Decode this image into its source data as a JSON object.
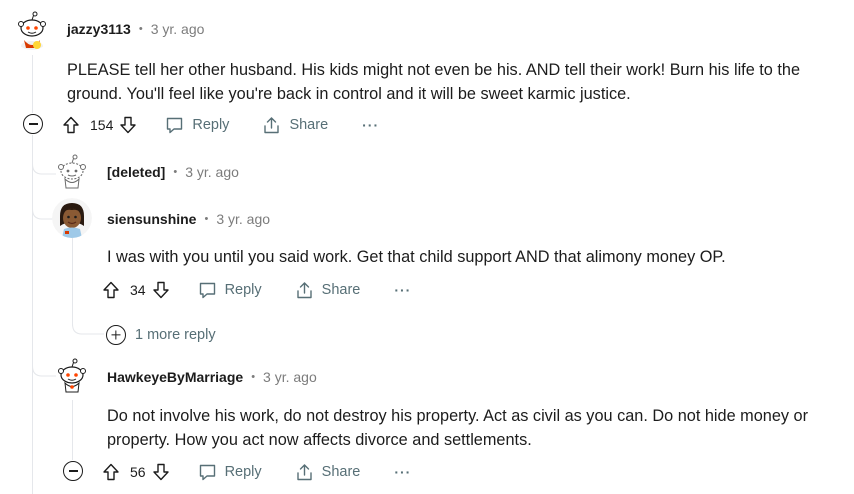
{
  "comments": [
    {
      "username": "jazzy3113",
      "time": "3 yr. ago",
      "body": "PLEASE tell her other husband. His kids might not even be his. AND tell their work! Burn his life to the ground. You'll feel like you're back in control and it will be sweet karmic justice.",
      "votes": "154",
      "reply_label": "Reply",
      "share_label": "Share",
      "more_label": "···",
      "avatar_icon": "snoo-avatar-icon"
    },
    {
      "username": "[deleted]",
      "time": "3 yr. ago",
      "avatar_icon": "deleted-snoo-avatar-icon"
    },
    {
      "username": "siensunshine",
      "time": "3 yr. ago",
      "body": "I was with you until you said work. Get that child support AND that alimony money OP.",
      "votes": "34",
      "reply_label": "Reply",
      "share_label": "Share",
      "more_label": "···",
      "avatar_icon": "custom-avatar-icon"
    },
    {
      "username": "HawkeyeByMarriage",
      "time": "3 yr. ago",
      "body": "Do not involve his work, do not destroy his property. Act as civil as you can. Do not hide money or property. How you act now affects divorce and settlements.",
      "votes": "56",
      "reply_label": "Reply",
      "share_label": "Share",
      "more_label": "···",
      "avatar_icon": "snoo-avatar-icon"
    }
  ],
  "more_replies_label": "1 more reply",
  "separator": "•",
  "colors": {
    "text": "#1c1c1c",
    "muted": "#576f76",
    "meta": "#7c7c7c",
    "thread": "#e5e7eb"
  }
}
